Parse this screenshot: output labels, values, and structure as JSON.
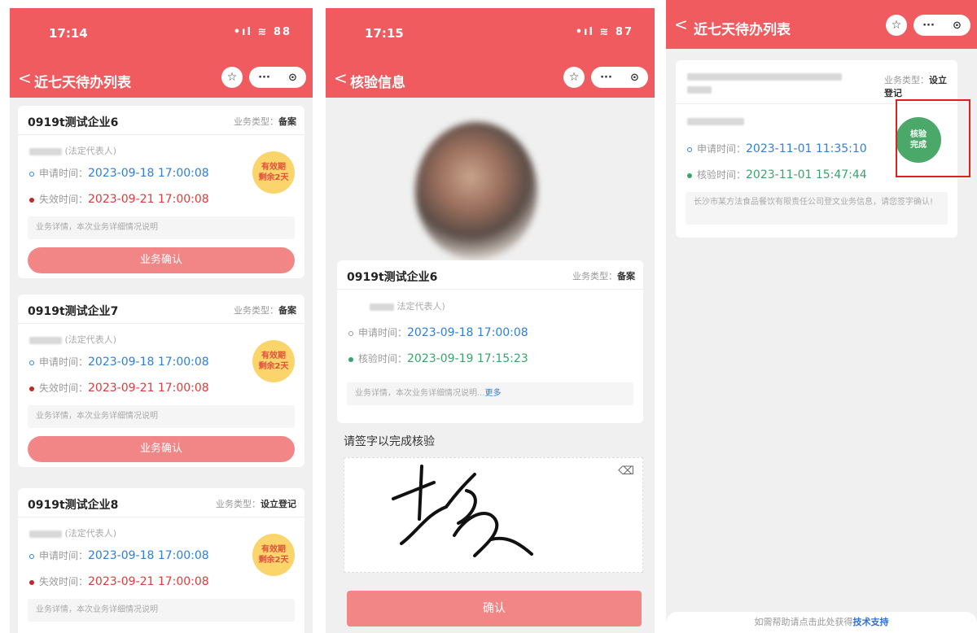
{
  "panel1": {
    "status_time": "17:14",
    "status_icons": "•ıl ≋ 88",
    "nav_back": "<",
    "nav_title": "近七天待办列表",
    "cards": [
      {
        "company": "0919t测试企业6",
        "type_label": "业务类型：",
        "type_value": "备案",
        "rep": "(法定代表人)",
        "apply_label": "申请时间：",
        "apply_time": "2023-09-18 17:00:08",
        "expire_label": "失效时间：",
        "expire_time": "2023-09-21 17:00:08",
        "detail": "业务详情，本次业务详细情况说明",
        "badge1": "有效期",
        "badge2": "剩余2天",
        "button": "业务确认"
      },
      {
        "company": "0919t测试企业7",
        "type_label": "业务类型：",
        "type_value": "备案",
        "rep": "(法定代表人)",
        "apply_label": "申请时间：",
        "apply_time": "2023-09-18 17:00:08",
        "expire_label": "失效时间：",
        "expire_time": "2023-09-21 17:00:08",
        "detail": "业务详情，本次业务详细情况说明",
        "badge1": "有效期",
        "badge2": "剩余2天",
        "button": "业务确认"
      },
      {
        "company": "0919t测试企业8",
        "type_label": "业务类型：",
        "type_value": "设立登记",
        "rep": "(法定代表人)",
        "apply_label": "申请时间：",
        "apply_time": "2023-09-18 17:00:08",
        "expire_label": "失效时间：",
        "expire_time": "2023-09-21 17:00:08",
        "detail": "业务详情，本次业务详细情况说明",
        "badge1": "有效期",
        "badge2": "剩余2天"
      }
    ]
  },
  "panel2": {
    "status_time": "17:15",
    "status_icons": "•ıl ≋ 87",
    "nav_back": "<",
    "nav_title": "核验信息",
    "company": "0919t测试企业6",
    "type_label": "业务类型：",
    "type_value": "备案",
    "rep": "法定代表人)",
    "apply_label": "申请时间：",
    "apply_time": "2023-09-18 17:00:08",
    "verify_label": "核验时间：",
    "verify_time": "2023-09-19 17:15:23",
    "detail": "业务详情，本次业务详细情况说明...",
    "detail_more": "更多",
    "sign_title": "请签字以完成核验",
    "erase_icon": "⌫",
    "ok_button": "确认"
  },
  "panel3": {
    "nav_back": "<",
    "nav_title": "近七天待办列表",
    "type_label": "业务类型：",
    "type_value": "设立登记",
    "apply_label": "申请时间：",
    "apply_time": "2023-11-01 11:35:10",
    "verify_label": "核验时间：",
    "verify_time": "2023-11-01 15:47:44",
    "detail": "长沙市某方法食品餐饮有限责任公司登文业务信息，请您签字确认!",
    "done1": "核验",
    "done2": "完成",
    "help_text": "如需帮助请点击此处获得",
    "help_link": "技术支持"
  },
  "capsule": {
    "star": "☆",
    "more": "···",
    "close": "⊙"
  },
  "colors": {
    "brand": "#ef5b5e",
    "button": "#f28686",
    "done": "#4aa868",
    "badge": "#fbd46b"
  }
}
